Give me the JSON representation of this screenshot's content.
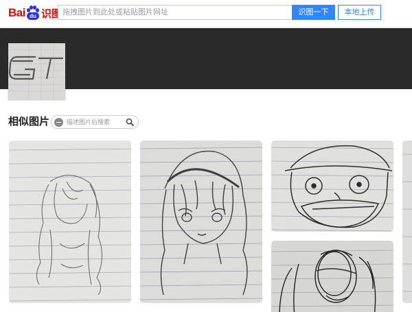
{
  "header": {
    "logo_bai": "Bai",
    "logo_du": "du",
    "logo_suffix": "识图",
    "search_placeholder": "拖拽图片到此处或粘贴图片网址",
    "shitu_button": "识图一下",
    "upload_button": "本地上传"
  },
  "similar": {
    "title": "相似图片",
    "search_placeholder": "描述图片后搜索"
  },
  "icons": {
    "search": "magnifier-icon",
    "tag": "tag-icon"
  },
  "colors": {
    "brand_red": "#e10602",
    "brand_blue": "#2932e1",
    "accent_blue": "#3385ff",
    "banner": "#2a2a2a"
  }
}
